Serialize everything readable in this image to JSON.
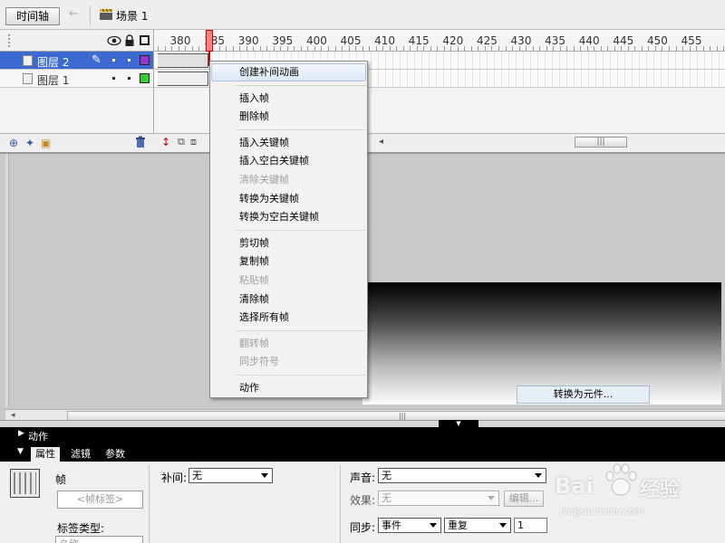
{
  "toolbar": {
    "timeline_button": "时间轴",
    "scene_label": "场景 1"
  },
  "timeline": {
    "ruler_ticks": [
      "380",
      "385",
      "390",
      "395",
      "400",
      "405",
      "410",
      "415",
      "420",
      "425",
      "430",
      "435",
      "440",
      "445",
      "450",
      "455"
    ],
    "layers": [
      {
        "name": "图层 2",
        "selected": true,
        "color": "#9933cc"
      },
      {
        "name": "图层 1",
        "selected": false,
        "color": "#33cc33"
      }
    ]
  },
  "context_menu": {
    "groups": [
      [
        {
          "label": "创建补间动画",
          "enabled": true,
          "highlighted": true
        }
      ],
      [
        {
          "label": "插入帧",
          "enabled": true
        },
        {
          "label": "删除帧",
          "enabled": true
        }
      ],
      [
        {
          "label": "插入关键帧",
          "enabled": true
        },
        {
          "label": "插入空白关键帧",
          "enabled": true
        },
        {
          "label": "清除关键帧",
          "enabled": false
        },
        {
          "label": "转换为关键帧",
          "enabled": true
        },
        {
          "label": "转换为空白关键帧",
          "enabled": true
        }
      ],
      [
        {
          "label": "剪切帧",
          "enabled": true
        },
        {
          "label": "复制帧",
          "enabled": true
        },
        {
          "label": "粘贴帧",
          "enabled": false
        },
        {
          "label": "清除帧",
          "enabled": true
        },
        {
          "label": "选择所有帧",
          "enabled": true
        }
      ],
      [
        {
          "label": "翻转帧",
          "enabled": false
        },
        {
          "label": "同步符号",
          "enabled": false
        }
      ],
      [
        {
          "label": "动作",
          "enabled": true
        }
      ]
    ]
  },
  "stage": {
    "convert_to_symbol": "转换为元件..."
  },
  "panels": {
    "actions_label": "动作",
    "tabs": [
      "属性",
      "滤镜",
      "参数"
    ],
    "active_tab": "属性"
  },
  "properties": {
    "frame_label": "帧",
    "frame_label_placeholder": "<帧标签>",
    "label_type_label": "标签类型:",
    "label_type_value": "名称",
    "tween_label": "补间:",
    "tween_value": "无",
    "sound_label": "声音:",
    "sound_value": "无",
    "effect_label": "效果:",
    "effect_value": "无",
    "edit_button": "编辑...",
    "sync_label": "同步:",
    "sync_value": "事件",
    "repeat_value": "重复",
    "repeat_count": "1"
  },
  "watermark": {
    "left": "Bai",
    "right": "经验",
    "url": "jingyan.baidu.com"
  }
}
